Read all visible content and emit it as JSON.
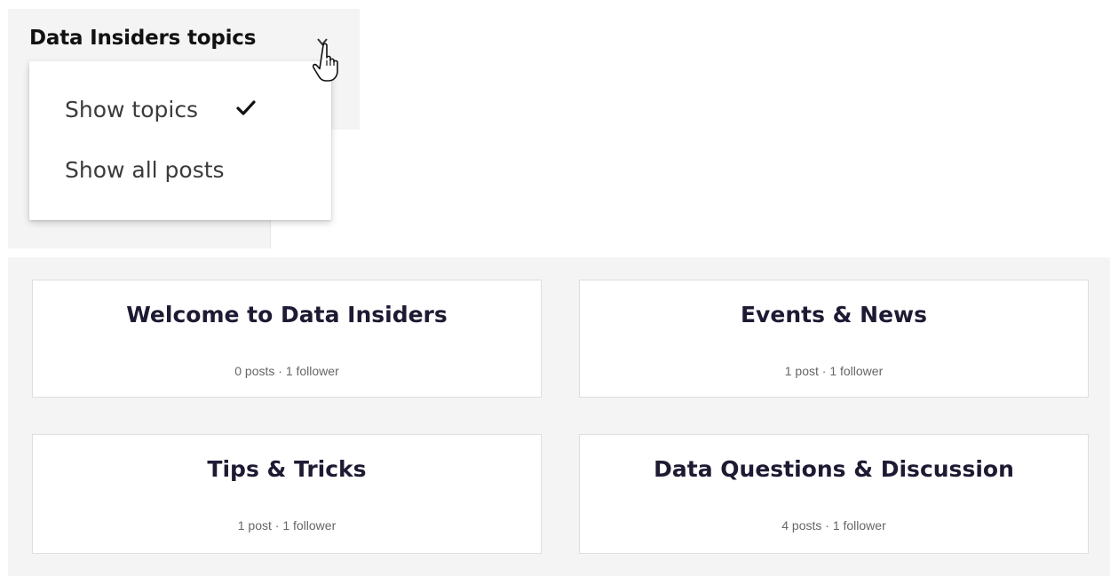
{
  "header": {
    "title": "Data Insiders topics",
    "dropdown_icon": "chevron-down-icon",
    "cursor_icon": "hand-pointer-icon"
  },
  "menu": {
    "items": [
      {
        "label": "Show topics",
        "selected": true,
        "check_icon": "checkmark-icon"
      },
      {
        "label": "Show all posts",
        "selected": false
      }
    ]
  },
  "topics": [
    {
      "title": "Welcome to Data Insiders",
      "posts": "0 posts",
      "separator": "·",
      "followers": "1 follower"
    },
    {
      "title": "Events & News",
      "posts": "1 post",
      "separator": "·",
      "followers": "1 follower"
    },
    {
      "title": "Tips & Tricks",
      "posts": "1 post",
      "separator": "·",
      "followers": "1 follower"
    },
    {
      "title": "Data Questions & Discussion",
      "posts": "4 posts",
      "separator": "·",
      "followers": "1 follower"
    }
  ]
}
